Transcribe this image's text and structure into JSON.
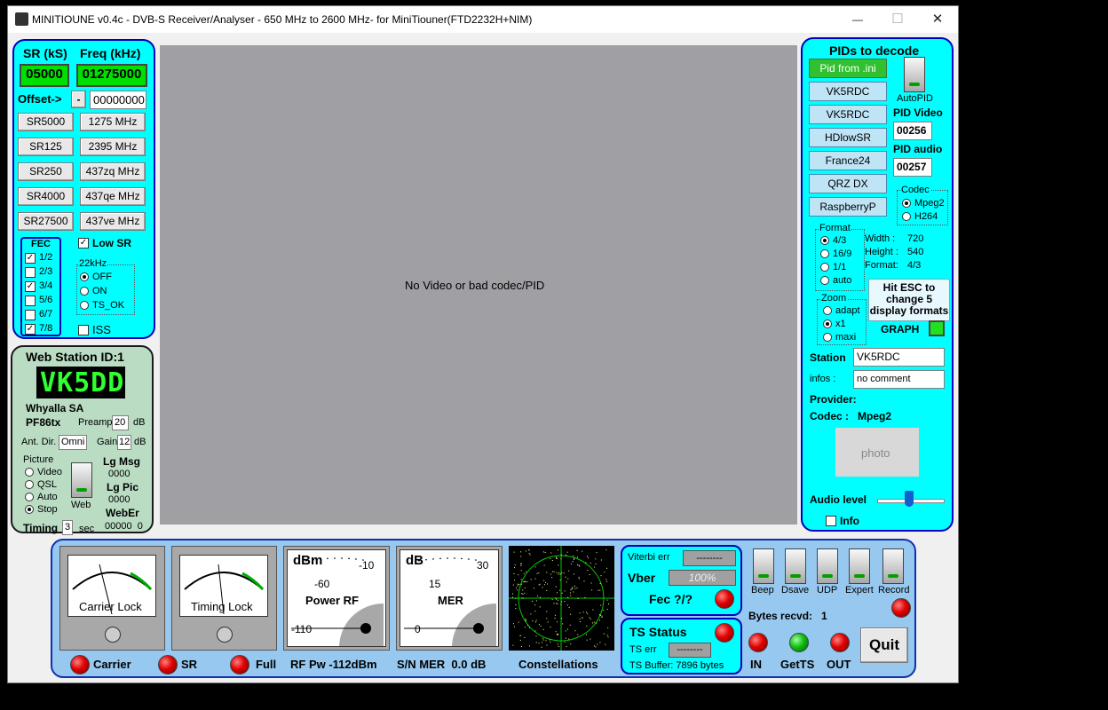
{
  "window": {
    "title": "MINITIOUNE v0.4c - DVB-S Receiver/Analyser - 650 MHz to 2600 MHz- for MiniTiouner(FTD2232H+NIM)",
    "min": "—",
    "max": "☐",
    "close": "✕"
  },
  "tuning": {
    "sr_label": "SR (kS)",
    "freq_label": "Freq (kHz)",
    "sr_value": "05000",
    "freq_value": "01275000",
    "offset_label": "Offset->",
    "offset_sign": "-",
    "offset_value": "00000000",
    "sr_buttons": [
      "SR5000",
      "SR125",
      "SR250",
      "SR4000",
      "SR27500"
    ],
    "freq_buttons": [
      "1275 MHz",
      "2395 MHz",
      "437zq MHz",
      "437qe MHz",
      "437ve MHz"
    ],
    "fec_label": "FEC",
    "fec": [
      "1/2",
      "2/3",
      "3/4",
      "5/6",
      "6/7",
      "7/8"
    ],
    "fec_checked": [
      "✓",
      "",
      "✓",
      "",
      "",
      "✓"
    ],
    "low_sr_label": "Low SR",
    "low_sr_check": "✓",
    "khz_label": "22kHz",
    "khz_options": [
      "OFF",
      "ON",
      "TS_OK"
    ],
    "iss_label": "ISS"
  },
  "station": {
    "title": "Web Station ID:1",
    "callsign": "VK5DD",
    "location": "Whyalla SA",
    "tx": "PF86tx",
    "preamp_label": "Preamp",
    "preamp": "20",
    "db": "dB",
    "ant_label": "Ant. Dir.",
    "ant": "Omni",
    "gain_label": "Gain",
    "gain": "12",
    "db2": "dB",
    "picture_label": "Picture",
    "picture_options": [
      "Video",
      "QSL",
      "Auto",
      "Stop"
    ],
    "web_label": "Web",
    "lg_msg_label": "Lg Msg",
    "lg_msg": "0000",
    "lg_pic_label": "Lg Pic",
    "lg_pic": "0000",
    "weber_label": "WebEr",
    "weber": "00000  0",
    "timing_label": "Timing",
    "timing": "3",
    "sec": "sec"
  },
  "video": {
    "message": "No Video or bad codec/PID"
  },
  "pids": {
    "title": "PIDs to decode",
    "pid_ini": "Pid from .ini",
    "presets": [
      "VK5RDC",
      "VK5RDC",
      "HDlowSR",
      "France24",
      "QRZ DX",
      "RaspberryP"
    ],
    "autopid": "AutoPID",
    "pid_video_label": "PID Video",
    "pid_video": "00256",
    "pid_audio_label": "PID audio",
    "pid_audio": "00257",
    "codec_label": "Codec",
    "codec_options": [
      "Mpeg2",
      "H264"
    ],
    "format_label": "Format",
    "format_options": [
      "4/3",
      "16/9",
      "1/1",
      "auto"
    ],
    "width_label": "Width :",
    "width": "720",
    "height_label": "Height :",
    "height": "540",
    "fmt_label": "Format:",
    "fmt": "4/3",
    "esc_hint": "Hit ESC to change  5 display formats",
    "zoom_label": "Zoom",
    "zoom_options": [
      "adapt",
      "x1",
      "maxi"
    ],
    "graph_label": "GRAPH",
    "station_label": "Station",
    "station": "VK5RDC",
    "infos_label": "infos :",
    "infos": "no comment",
    "provider_label": "Provider:",
    "codec_info_label": "Codec :",
    "codec_info": "Mpeg2",
    "photo": "photo",
    "audio_label": "Audio level",
    "info_label": "Info"
  },
  "bottom": {
    "carrier_lock": "Carrier Lock",
    "timing_lock": "Timing Lock",
    "power_unit": "dBm",
    "power_label": "Power RF",
    "power_ticks": [
      "-10",
      "-60",
      "-110"
    ],
    "mer_unit": "dB",
    "mer_label": "MER",
    "mer_ticks": [
      "30",
      "15",
      "0"
    ],
    "carrier": "Carrier",
    "sr": "SR",
    "full": "Full",
    "rf_pw": "RF Pw -112dBm",
    "sn_mer": "S/N MER  0.0 dB",
    "constellations": "Constellations",
    "viterbi_label": "Viterbi err",
    "viterbi": "--------",
    "vber_label": "Vber",
    "vber": "100%",
    "fec_label": "Fec ?/?",
    "ts_status": "TS Status",
    "ts_err_label": "TS err",
    "ts_err": "--------",
    "ts_buffer": "TS Buffer: 7896 bytes",
    "switches": [
      "Beep",
      "Dsave",
      "UDP",
      "Expert",
      "Record"
    ],
    "bytes": "Bytes recvd:   1",
    "in": "IN",
    "getts": "GetTS",
    "out": "OUT",
    "quit": "Quit"
  }
}
